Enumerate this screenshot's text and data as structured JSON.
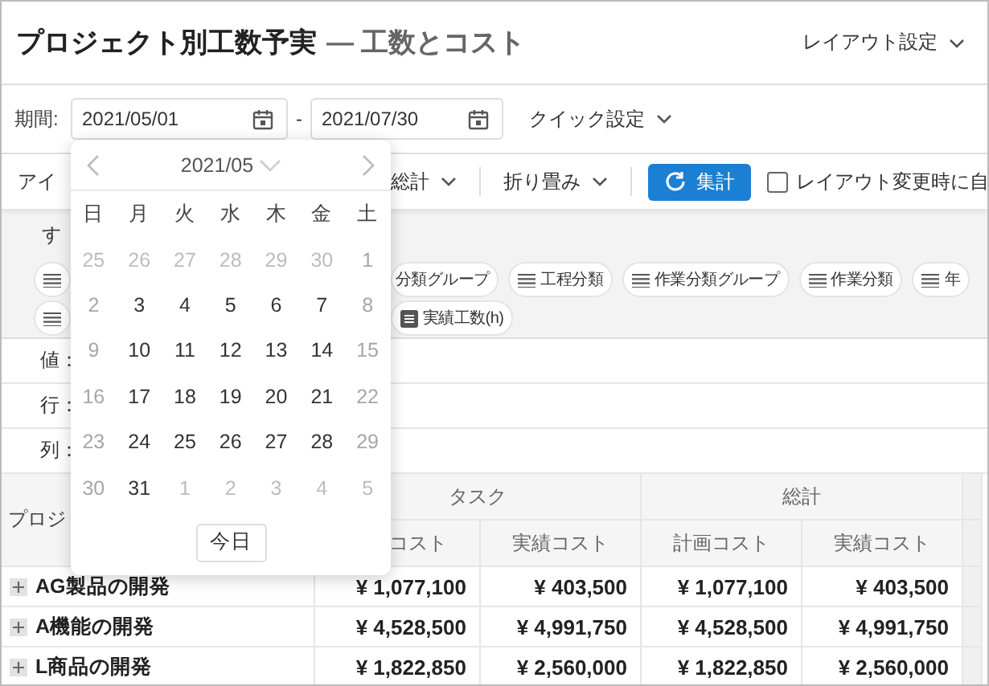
{
  "header": {
    "title": "プロジェクト別工数予実",
    "subtitle": "— 工数とコスト",
    "layout_menu": "レイアウト設定"
  },
  "period": {
    "label": "期間:",
    "start": "2021/05/01",
    "separator": "-",
    "end": "2021/07/30",
    "quick": "クイック設定"
  },
  "toolbar": {
    "items_label": "アイ",
    "total": "総計",
    "collapse": "折り畳み",
    "aggregate": "集計",
    "auto_checkbox": {
      "label": "レイアウト変更時に自",
      "checked": false
    }
  },
  "fields": {
    "all_label": "す",
    "chip_rows": [
      [
        {
          "kind": "dimension"
        },
        {
          "label": "分類グループ",
          "kind": "partial"
        },
        {
          "label": "工程分類",
          "kind": "dimension"
        },
        {
          "label": "作業分類グループ",
          "kind": "dimension"
        },
        {
          "label": "作業分類",
          "kind": "dimension"
        },
        {
          "label": "年",
          "kind": "dimension"
        }
      ],
      [
        {
          "kind": "dimension"
        },
        {
          "label": "実績工数(h)",
          "kind": "measure"
        }
      ]
    ]
  },
  "shelves": [
    {
      "label": "値："
    },
    {
      "label": "行："
    },
    {
      "label": "列："
    }
  ],
  "calendar": {
    "month": "2021/05",
    "weekdays": [
      "日",
      "月",
      "火",
      "水",
      "木",
      "金",
      "土"
    ],
    "weeks": [
      [
        {
          "day": "25",
          "kind": "outside"
        },
        {
          "day": "26",
          "kind": "outside"
        },
        {
          "day": "27",
          "kind": "outside"
        },
        {
          "day": "28",
          "kind": "outside"
        },
        {
          "day": "29",
          "kind": "outside"
        },
        {
          "day": "30",
          "kind": "outside"
        },
        {
          "day": "1",
          "kind": "weekend"
        }
      ],
      [
        {
          "day": "2",
          "kind": "weekend"
        },
        {
          "day": "3",
          "kind": "weekday"
        },
        {
          "day": "4",
          "kind": "weekday"
        },
        {
          "day": "5",
          "kind": "weekday"
        },
        {
          "day": "6",
          "kind": "weekday"
        },
        {
          "day": "7",
          "kind": "weekday"
        },
        {
          "day": "8",
          "kind": "weekend"
        }
      ],
      [
        {
          "day": "9",
          "kind": "weekend"
        },
        {
          "day": "10",
          "kind": "weekday"
        },
        {
          "day": "11",
          "kind": "weekday"
        },
        {
          "day": "12",
          "kind": "weekday"
        },
        {
          "day": "13",
          "kind": "weekday"
        },
        {
          "day": "14",
          "kind": "weekday"
        },
        {
          "day": "15",
          "kind": "weekend"
        }
      ],
      [
        {
          "day": "16",
          "kind": "weekend"
        },
        {
          "day": "17",
          "kind": "weekday"
        },
        {
          "day": "18",
          "kind": "weekday"
        },
        {
          "day": "19",
          "kind": "weekday"
        },
        {
          "day": "20",
          "kind": "weekday"
        },
        {
          "day": "21",
          "kind": "weekday"
        },
        {
          "day": "22",
          "kind": "weekend"
        }
      ],
      [
        {
          "day": "23",
          "kind": "weekend"
        },
        {
          "day": "24",
          "kind": "weekday"
        },
        {
          "day": "25",
          "kind": "weekday"
        },
        {
          "day": "26",
          "kind": "weekday"
        },
        {
          "day": "27",
          "kind": "weekday"
        },
        {
          "day": "28",
          "kind": "weekday"
        },
        {
          "day": "29",
          "kind": "weekend"
        }
      ],
      [
        {
          "day": "30",
          "kind": "weekend"
        },
        {
          "day": "31",
          "kind": "weekday"
        },
        {
          "day": "1",
          "kind": "outside"
        },
        {
          "day": "2",
          "kind": "outside"
        },
        {
          "day": "3",
          "kind": "outside"
        },
        {
          "day": "4",
          "kind": "outside"
        },
        {
          "day": "5",
          "kind": "outside"
        }
      ]
    ],
    "today": "今日"
  },
  "table": {
    "corner": "プロジ",
    "groups": [
      "タスク",
      "総計"
    ],
    "columns": [
      "コスト",
      "実績コスト",
      "計画コスト",
      "実績コスト"
    ],
    "rows": [
      {
        "name": "AG製品の開発",
        "values": [
          "¥ 1,077,100",
          "¥ 403,500",
          "¥ 1,077,100",
          "¥ 403,500"
        ]
      },
      {
        "name": "A機能の開発",
        "values": [
          "¥ 4,528,500",
          "¥ 4,991,750",
          "¥ 4,528,500",
          "¥ 4,991,750"
        ]
      },
      {
        "name": "L商品の開発",
        "values": [
          "¥ 1,822,850",
          "¥ 2,560,000",
          "¥ 1,822,850",
          "¥ 2,560,000"
        ]
      }
    ]
  }
}
